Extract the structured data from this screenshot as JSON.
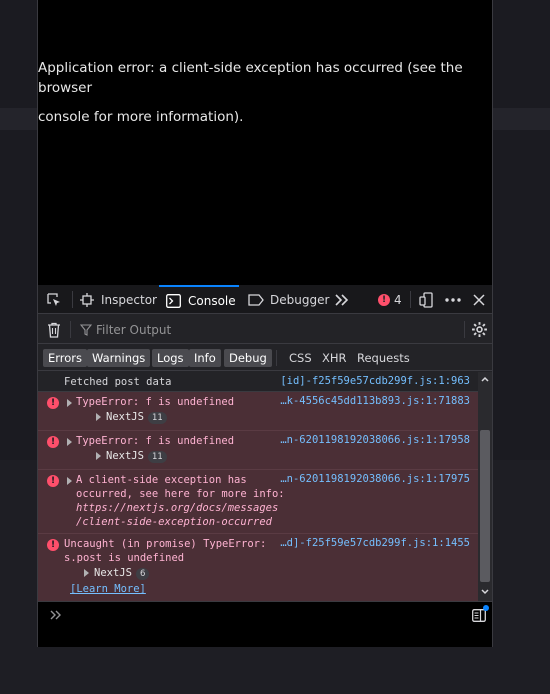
{
  "page": {
    "error_line1": "Application error: a client-side exception has occurred (see the browser",
    "error_line2": "console for more information)."
  },
  "toolbar": {
    "tabs": [
      {
        "label": "Inspector",
        "icon": "inspector-icon"
      },
      {
        "label": "Console",
        "icon": "console-icon"
      },
      {
        "label": "Debugger",
        "icon": "debugger-icon"
      }
    ],
    "overflow_icon": "chevrons-right-icon",
    "error_count": "4",
    "error_icon": "error-icon",
    "responsive_icon": "responsive-design-icon",
    "more_icon": "more-icon",
    "close_icon": "close-icon"
  },
  "filter": {
    "placeholder": "Filter Output",
    "trash_icon": "trash-icon",
    "settings_icon": "gear-icon"
  },
  "levels": {
    "buttons": [
      "Errors",
      "Warnings",
      "Logs",
      "Info",
      "Debug"
    ],
    "net": [
      "CSS",
      "XHR",
      "Requests"
    ]
  },
  "messages": [
    {
      "type": "log",
      "text": "Fetched post data",
      "source": "[id]-f25f59e57cdb299f.js:1:963"
    },
    {
      "type": "error",
      "text": "TypeError: f is undefined",
      "sub": "NextJS",
      "count": "11",
      "source": "…k-4556c45dd113b893.js:1:71883"
    },
    {
      "type": "error",
      "text": "TypeError: f is undefined",
      "sub": "NextJS",
      "count": "11",
      "source": "…n-6201198192038066.js:1:17958"
    },
    {
      "type": "error",
      "lines": [
        "A client-side exception has",
        "occurred, see here for more info:"
      ],
      "link_lines": [
        "https://nextjs.org/docs/messages",
        "/client-side-exception-occurred"
      ],
      "source": "…n-6201198192038066.js:1:17975"
    },
    {
      "type": "error",
      "lines": [
        "Uncaught (in promise) TypeError:",
        "s.post is undefined"
      ],
      "sub": "NextJS",
      "count": "6",
      "learn_more": "[Learn More]",
      "source": "…d]-f25f59e57cdb299f.js:1:1455"
    }
  ],
  "input": {
    "prompt_icon": "chevrons-right-icon",
    "sidebar_icon": "sidebar-toggle-icon"
  },
  "colors": {
    "accent": "#0a84ff",
    "error_bg": "#4b2f36",
    "error_text": "#ffb3d2",
    "source_link": "#75bfff"
  }
}
